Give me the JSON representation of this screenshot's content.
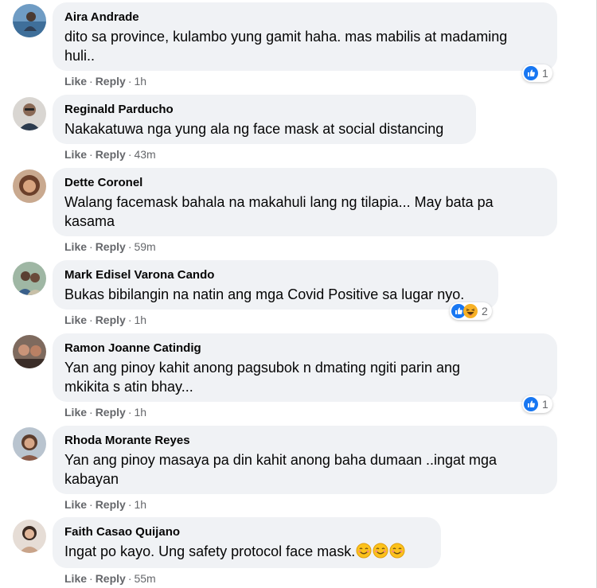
{
  "comments": [
    {
      "name": "Aira Andrade",
      "lines": [
        "dito sa province, kulambo yung gamit haha. mas mabilis at madaming",
        "huli.."
      ],
      "like": "Like",
      "reply": "Reply",
      "time": "1h",
      "reaction_count": "1",
      "reactions": [
        "like-icon"
      ]
    },
    {
      "name": "Reginald Parducho",
      "lines": [
        "Nakakatuwa nga yung ala ng face mask at social distancing"
      ],
      "like": "Like",
      "reply": "Reply",
      "time": "43m"
    },
    {
      "name": "Dette Coronel",
      "lines": [
        "Walang facemask bahala na makahuli lang ng tilapia... May bata pa",
        "kasama"
      ],
      "like": "Like",
      "reply": "Reply",
      "time": "59m"
    },
    {
      "name": "Mark Edisel Varona Cando",
      "lines": [
        "Bukas bibilangin na natin ang mga Covid Positive sa lugar nyo."
      ],
      "like": "Like",
      "reply": "Reply",
      "time": "1h",
      "reaction_count": "2",
      "reactions": [
        "like-icon",
        "haha-icon"
      ]
    },
    {
      "name": "Ramon Joanne Catindig",
      "lines": [
        "Yan ang pinoy kahit anong pagsubok n dmating ngiti parin ang",
        "mkikita s atin bhay..."
      ],
      "like": "Like",
      "reply": "Reply",
      "time": "1h",
      "reaction_count": "1",
      "reactions": [
        "like-icon"
      ]
    },
    {
      "name": "Rhoda Morante Reyes",
      "lines": [
        "Yan ang pinoy masaya pa din kahit anong baha dumaan ..ingat mga",
        "kabayan"
      ],
      "like": "Like",
      "reply": "Reply",
      "time": "1h"
    },
    {
      "name": "Faith Casao Quijano",
      "lines": [
        "Ingat po kayo. Ung safety protocol face mask."
      ],
      "like": "Like",
      "reply": "Reply",
      "time": "55m",
      "inline_emoji": [
        "smile-icon",
        "smile-icon",
        "smile-icon"
      ]
    }
  ],
  "colors": {
    "bubble": "#f0f2f5",
    "meta": "#65676b",
    "like_blue": "#1877f2",
    "haha_yellow": "#f7b125"
  }
}
